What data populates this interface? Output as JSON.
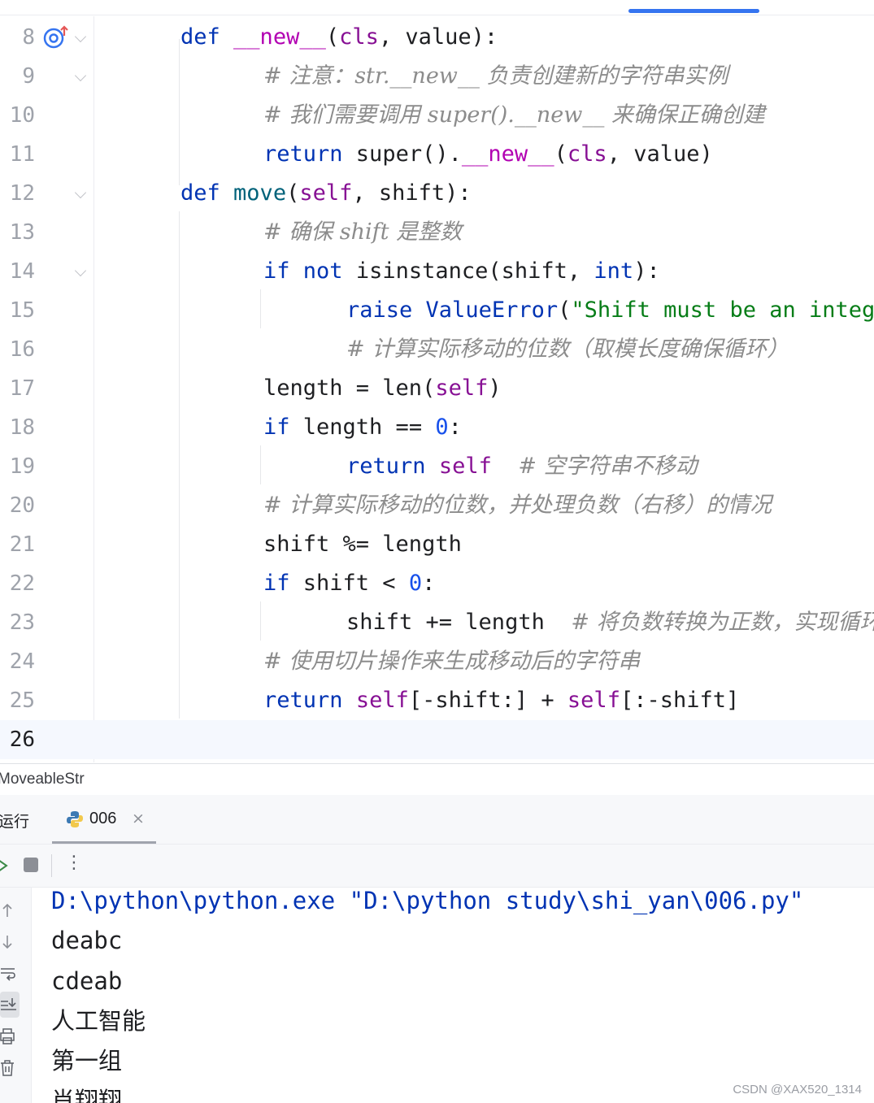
{
  "editor": {
    "lines": [
      {
        "num": "8",
        "tokens": [
          {
            "t": "def",
            "c": "k"
          },
          {
            "t": " "
          },
          {
            "t": "__new__",
            "c": "m"
          },
          {
            "t": "("
          },
          {
            "t": "cls",
            "c": "p"
          },
          {
            "t": ", value):"
          }
        ]
      },
      {
        "num": "9",
        "tokens": [
          {
            "t": "# 注意：str.__new__ 负责创建新的字符串实例",
            "c": "c"
          }
        ]
      },
      {
        "num": "10",
        "tokens": [
          {
            "t": "# 我们需要调用 super().__new__ 来确保正确创建",
            "c": "c"
          }
        ]
      },
      {
        "num": "11",
        "tokens": [
          {
            "t": "return",
            "c": "k"
          },
          {
            "t": " super()."
          },
          {
            "t": "__new__",
            "c": "m"
          },
          {
            "t": "("
          },
          {
            "t": "cls",
            "c": "p"
          },
          {
            "t": ", value)"
          }
        ]
      },
      {
        "num": "12",
        "tokens": [
          {
            "t": "def",
            "c": "k"
          },
          {
            "t": " "
          },
          {
            "t": "move",
            "c": "f"
          },
          {
            "t": "("
          },
          {
            "t": "self",
            "c": "p"
          },
          {
            "t": ", shift):"
          }
        ]
      },
      {
        "num": "13",
        "tokens": [
          {
            "t": "# 确保 shift 是整数",
            "c": "c"
          }
        ]
      },
      {
        "num": "14",
        "tokens": [
          {
            "t": "if",
            "c": "k"
          },
          {
            "t": " "
          },
          {
            "t": "not",
            "c": "k"
          },
          {
            "t": " isinstance(shift, "
          },
          {
            "t": "int",
            "c": "k"
          },
          {
            "t": "):"
          }
        ]
      },
      {
        "num": "15",
        "tokens": [
          {
            "t": "raise",
            "c": "k"
          },
          {
            "t": " "
          },
          {
            "t": "ValueError",
            "c": "k"
          },
          {
            "t": "("
          },
          {
            "t": "\"Shift must be an integer\")",
            "c": "s"
          }
        ]
      },
      {
        "num": "16",
        "tokens": [
          {
            "t": "# 计算实际移动的位数（取模长度确保循环）",
            "c": "c"
          }
        ]
      },
      {
        "num": "17",
        "tokens": [
          {
            "t": "length = len("
          },
          {
            "t": "self",
            "c": "p"
          },
          {
            "t": ")"
          }
        ]
      },
      {
        "num": "18",
        "tokens": [
          {
            "t": "if",
            "c": "k"
          },
          {
            "t": " length == "
          },
          {
            "t": "0",
            "c": "n"
          },
          {
            "t": ":"
          }
        ]
      },
      {
        "num": "19",
        "tokens": [
          {
            "t": "return",
            "c": "k"
          },
          {
            "t": " "
          },
          {
            "t": "self",
            "c": "p"
          },
          {
            "t": "  "
          },
          {
            "t": "# 空字符串不移动",
            "c": "c"
          }
        ]
      },
      {
        "num": "20",
        "tokens": [
          {
            "t": "# 计算实际移动的位数，并处理负数（右移）的情况",
            "c": "c"
          }
        ]
      },
      {
        "num": "21",
        "tokens": [
          {
            "t": "shift %= length"
          }
        ]
      },
      {
        "num": "22",
        "tokens": [
          {
            "t": "if",
            "c": "k"
          },
          {
            "t": " shift < "
          },
          {
            "t": "0",
            "c": "n"
          },
          {
            "t": ":"
          }
        ]
      },
      {
        "num": "23",
        "tokens": [
          {
            "t": "shift += length  "
          },
          {
            "t": "# 将负数转换为正数，实现循环",
            "c": "c"
          }
        ]
      },
      {
        "num": "24",
        "tokens": [
          {
            "t": "# 使用切片操作来生成移动后的字符串",
            "c": "c"
          }
        ]
      },
      {
        "num": "25",
        "tokens": [
          {
            "t": "return",
            "c": "k"
          },
          {
            "t": " "
          },
          {
            "t": "self",
            "c": "p"
          },
          {
            "t": "[-shift:] + "
          },
          {
            "t": "self",
            "c": "p"
          },
          {
            "t": "[:-shift]"
          }
        ]
      },
      {
        "num": "26",
        "tokens": []
      }
    ],
    "current_line": "26"
  },
  "breadcrumb": "MoveableStr",
  "run_panel": {
    "run_label": "运行",
    "tab_label": "006",
    "tab_close": "×",
    "more": "⋮"
  },
  "console": {
    "lines": [
      "D:\\python\\python.exe \"D:\\python study\\shi_yan\\006.py\"",
      "deabc",
      "cdeab",
      "人工智能",
      "第一组",
      "肖翔翔"
    ]
  },
  "watermark": "CSDN @XAX520_1314"
}
